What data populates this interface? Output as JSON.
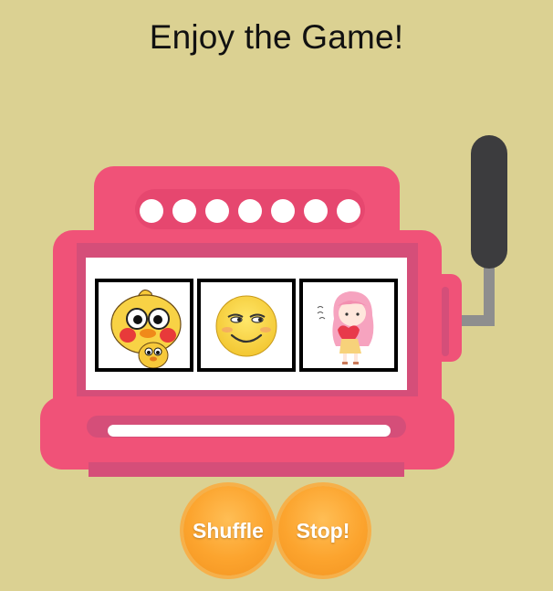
{
  "title": "Enjoy the Game!",
  "machine": {
    "lights": [
      "light",
      "light",
      "light",
      "light",
      "light",
      "light",
      "light"
    ],
    "reels": [
      {
        "icon": "yellow-duck-sticker-icon"
      },
      {
        "icon": "smug-smiley-face-icon"
      },
      {
        "icon": "pink-haired-girl-heart-icon"
      }
    ],
    "lever": {
      "icon": "lever-handle-icon"
    }
  },
  "buttons": {
    "shuffle_label": "Shuffle",
    "stop_label": "Stop!"
  },
  "colors": {
    "background": "#dbd192",
    "machine": "#f05278",
    "machine_shade": "#d54e79",
    "lever_knob": "#3c3c3e",
    "button": "#fca42e"
  }
}
